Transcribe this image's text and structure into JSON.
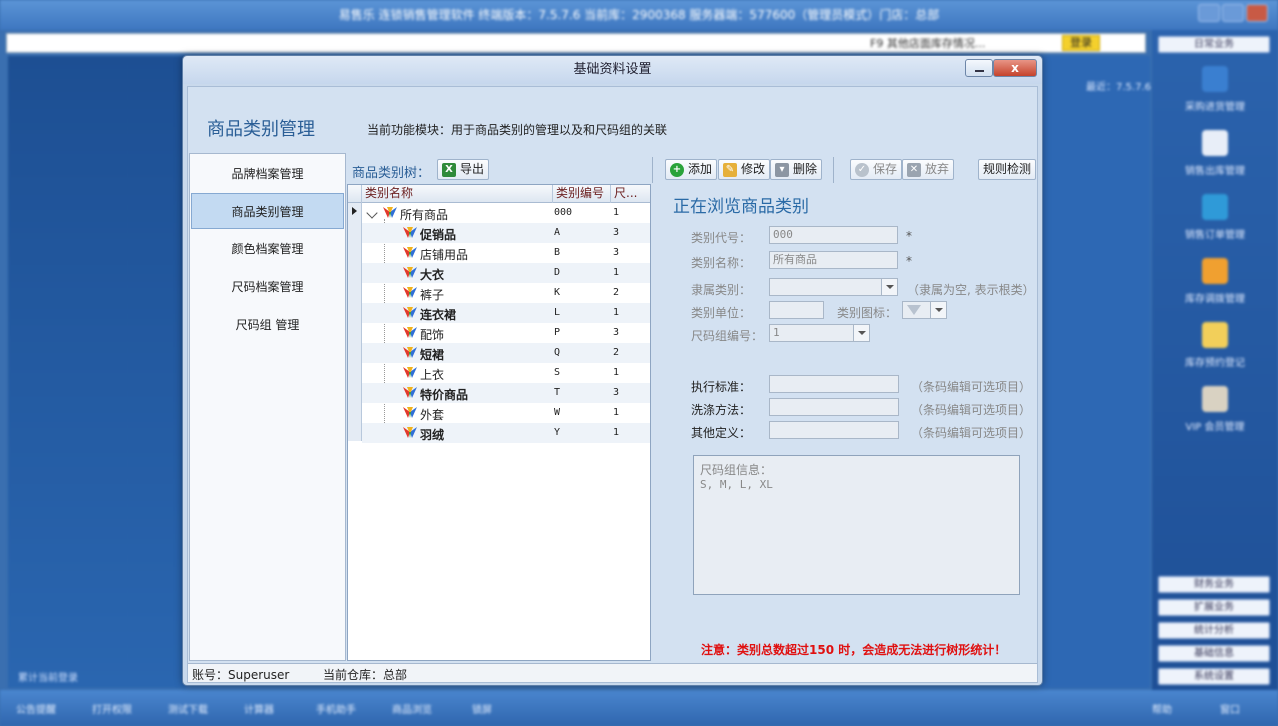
{
  "background": {
    "title": "易售乐 连锁销售管理软件 终端版本：7.5.7.6 当前库：2900368 服务器端：577600（管理员模式）门店：总部",
    "addr_right": "F9 其他店面库存情况...",
    "login": "登录",
    "left_text": "累计当前登录",
    "mid_text": "最近：7.5.7.6",
    "right_top": "日常业务",
    "right_items": [
      "采购进货管理",
      "销售出库管理",
      "销售订单管理",
      "库存调拨管理",
      "库存预约登记",
      "VIP 会员管理"
    ],
    "right_buttons": [
      "财务业务",
      "扩展业务",
      "统计分析",
      "基础信息",
      "系统设置"
    ],
    "bottom_items": [
      "公告提醒",
      "打开权限",
      "测试下载",
      "计算器",
      "手机助手",
      "商品浏览",
      "锁屏"
    ],
    "bottom_right": [
      "帮助",
      "窗口"
    ]
  },
  "dialog": {
    "title": "基础资料设置",
    "close_label": "x"
  },
  "module": {
    "title": "商品类别管理",
    "description": "当前功能模块：用于商品类别的管理以及和尺码组的关联"
  },
  "nav": {
    "items": [
      {
        "label": "品牌档案管理"
      },
      {
        "label": "商品类别管理"
      },
      {
        "label": "颜色档案管理"
      },
      {
        "label": "尺码档案管理"
      },
      {
        "label": "尺码组 管理"
      }
    ]
  },
  "toolbar": {
    "tree_label": "商品类别树：",
    "export": "导出",
    "add": "添加",
    "edit": "修改",
    "delete": "删除",
    "save": "保存",
    "discard": "放弃",
    "rule_check": "规则检测"
  },
  "grid": {
    "headers": [
      "类别名称",
      "类别编号",
      "尺..."
    ],
    "root": {
      "name": "所有商品",
      "code": "000",
      "count": "1"
    },
    "rows": [
      {
        "name": "促销品",
        "code": "A",
        "count": "3",
        "bold": true
      },
      {
        "name": "店铺用品",
        "code": "B",
        "count": "3",
        "bold": false
      },
      {
        "name": "大衣",
        "code": "D",
        "count": "1",
        "bold": true
      },
      {
        "name": "裤子",
        "code": "K",
        "count": "2",
        "bold": false
      },
      {
        "name": "连衣裙",
        "code": "L",
        "count": "1",
        "bold": true
      },
      {
        "name": "配饰",
        "code": "P",
        "count": "3",
        "bold": false
      },
      {
        "name": "短裙",
        "code": "Q",
        "count": "2",
        "bold": true
      },
      {
        "name": "上衣",
        "code": "S",
        "count": "1",
        "bold": false
      },
      {
        "name": "特价商品",
        "code": "T",
        "count": "3",
        "bold": true
      },
      {
        "name": "外套",
        "code": "W",
        "count": "1",
        "bold": false
      },
      {
        "name": "羽绒",
        "code": "Y",
        "count": "1",
        "bold": true
      }
    ]
  },
  "form": {
    "title": "正在浏览商品类别",
    "code_label": "类别代号：",
    "code_value": "000",
    "name_label": "类别名称：",
    "name_value": "所有商品",
    "parent_label": "隶属类别：",
    "parent_hint": "（隶属为空, 表示根类）",
    "unit_label": "类别单位：",
    "icon_label": "类别图标：",
    "sizegroup_label": "尺码组编号：",
    "sizegroup_value": "1",
    "standard_label": "执行标准：",
    "wash_label": "洗涤方法：",
    "other_label": "其他定义：",
    "optional_hint": "（条码编辑可选项目）",
    "star": "*",
    "sizeinfo_label": "尺码组信息：",
    "sizeinfo_value": "S, M, L, XL",
    "warning": "注意：类别总数超过150 时，会造成无法进行树形统计！"
  },
  "status": {
    "account": "账号：Superuser",
    "warehouse": "当前仓库：总部"
  },
  "colors": {
    "accent": "#2a5e96",
    "warning": "#e01010"
  }
}
